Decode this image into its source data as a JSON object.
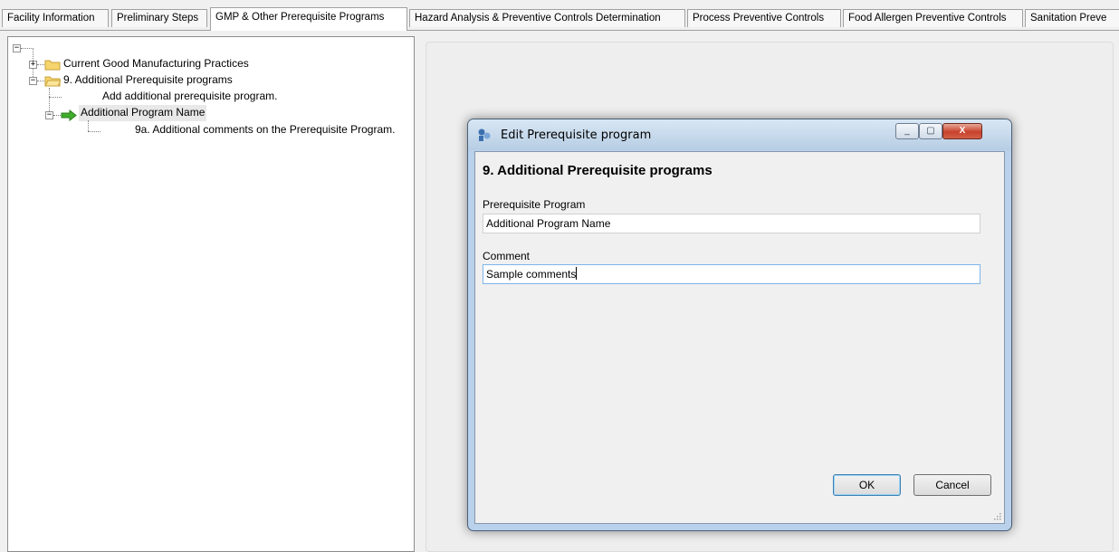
{
  "tabs": [
    {
      "label": "Facility Information",
      "active": false
    },
    {
      "label": "Preliminary Steps",
      "active": false
    },
    {
      "label": "GMP & Other Prerequisite Programs",
      "active": true
    },
    {
      "label": "Hazard Analysis & Preventive Controls Determination",
      "active": false
    },
    {
      "label": "Process Preventive Controls",
      "active": false
    },
    {
      "label": "Food Allergen Preventive Controls",
      "active": false
    },
    {
      "label": "Sanitation Preve",
      "active": false
    }
  ],
  "tree": {
    "items": [
      {
        "label": "Current Good Manufacturing Practices"
      },
      {
        "label": "9. Additional Prerequisite programs"
      },
      {
        "label": "Add additional prerequisite program."
      },
      {
        "label": "Additional Program Name"
      },
      {
        "label": "9a. Additional comments on the Prerequisite Program."
      }
    ]
  },
  "dialog": {
    "title": "Edit Prerequisite program",
    "heading": "9. Additional Prerequisite programs",
    "program_label": "Prerequisite Program",
    "program_value": "Additional Program Name",
    "comment_label": "Comment",
    "comment_value": "Sample comments",
    "ok_label": "OK",
    "cancel_label": "Cancel",
    "close_glyph": "X",
    "minimize_glyph": "_",
    "maximize_glyph": "▢"
  },
  "colors": {
    "folder": "#f5d46e",
    "arrow": "#3fae2a",
    "dialog_frame": "#b9d1ea",
    "close_button": "#c7412c"
  }
}
